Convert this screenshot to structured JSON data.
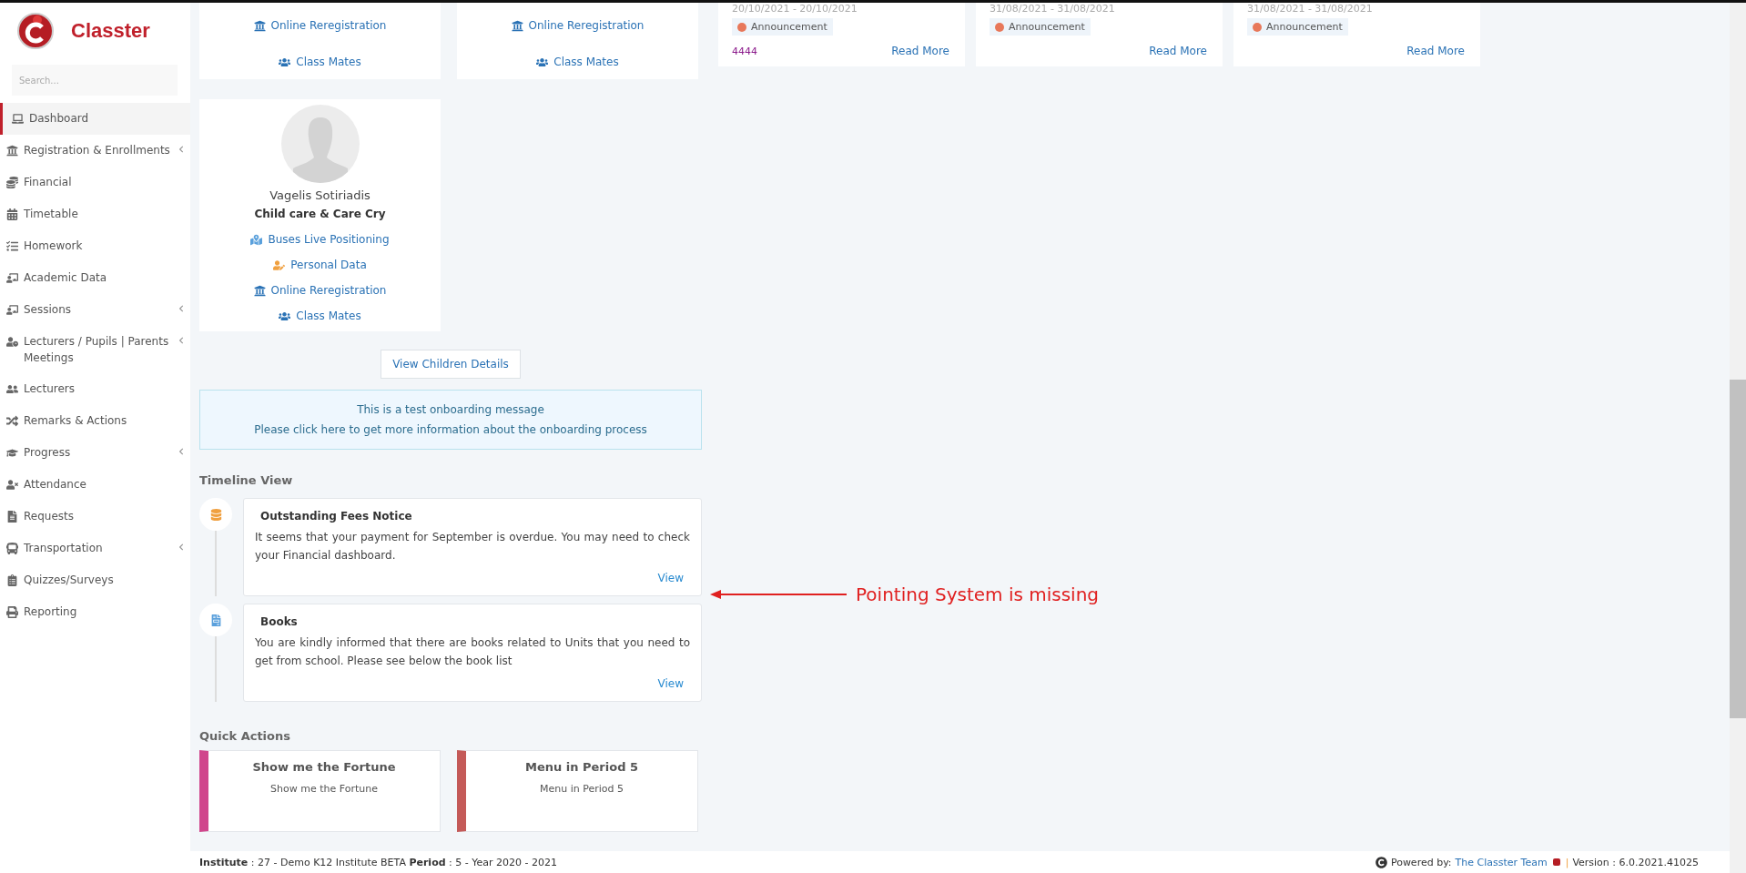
{
  "brand": {
    "name": "Classter"
  },
  "search": {
    "placeholder": "Search..."
  },
  "sidebar": {
    "items": [
      {
        "label": "Dashboard",
        "selected": true,
        "expandable": false
      },
      {
        "label": "Registration & Enrollments",
        "selected": false,
        "expandable": true
      },
      {
        "label": "Financial",
        "selected": false,
        "expandable": false
      },
      {
        "label": "Timetable",
        "selected": false,
        "expandable": false
      },
      {
        "label": "Homework",
        "selected": false,
        "expandable": false
      },
      {
        "label": "Academic Data",
        "selected": false,
        "expandable": false
      },
      {
        "label": "Sessions",
        "selected": false,
        "expandable": true
      },
      {
        "label": "Lecturers / Pupils | Parents Meetings",
        "selected": false,
        "expandable": true
      },
      {
        "label": "Lecturers",
        "selected": false,
        "expandable": false
      },
      {
        "label": "Remarks & Actions",
        "selected": false,
        "expandable": false
      },
      {
        "label": "Progress",
        "selected": false,
        "expandable": true
      },
      {
        "label": "Attendance",
        "selected": false,
        "expandable": false
      },
      {
        "label": "Requests",
        "selected": false,
        "expandable": false
      },
      {
        "label": "Transportation",
        "selected": false,
        "expandable": true
      },
      {
        "label": "Quizzes/Surveys",
        "selected": false,
        "expandable": false
      },
      {
        "label": "Reporting",
        "selected": false,
        "expandable": false
      }
    ]
  },
  "children_cards": [
    {
      "links": [
        {
          "kind": "registration",
          "label": "Online Reregistration"
        },
        {
          "kind": "classmates",
          "label": "Class Mates"
        }
      ]
    },
    {
      "links": [
        {
          "kind": "registration",
          "label": "Online Reregistration"
        },
        {
          "kind": "classmates",
          "label": "Class Mates"
        }
      ]
    },
    {
      "name": "Vagelis Sotiriadis",
      "school": "Child care & Care Cry",
      "links": [
        {
          "kind": "buses",
          "label": "Buses Live Positioning"
        },
        {
          "kind": "personal",
          "label": "Personal Data"
        },
        {
          "kind": "registration",
          "label": "Online Reregistration"
        },
        {
          "kind": "classmates",
          "label": "Class Mates"
        }
      ]
    }
  ],
  "view_children_button": "View Children Details",
  "onboarding": {
    "title": "This is a test onboarding message",
    "link": "Please click here to get more information about the onboarding process"
  },
  "events": [
    {
      "date": "20/10/2021 - 20/10/2021",
      "tag": "Announcement",
      "color": "#e8785a",
      "note": "4444",
      "link": "Read More"
    },
    {
      "date": "31/08/2021 - 31/08/2021",
      "tag": "Announcement",
      "color": "#e8785a",
      "link": "Read More"
    },
    {
      "date": "31/08/2021 - 31/08/2021",
      "tag": "Announcement",
      "color": "#e8785a",
      "link": "Read More"
    }
  ],
  "timeline": {
    "title": "Timeline View",
    "items": [
      {
        "kind": "fees",
        "title": "Outstanding Fees Notice",
        "text": "It seems that your payment for September is overdue. You may need to check your Financial dashboard.",
        "link": "View"
      },
      {
        "kind": "books",
        "title": "Books",
        "text": "You are kindly informed that there are books related to Units that you need to get from school. Please see below the book list",
        "link": "View"
      }
    ]
  },
  "quick_actions": {
    "title": "Quick Actions",
    "items": [
      {
        "title": "Show me the Fortune",
        "subtitle": "Show me the Fortune",
        "color": "#d0468c"
      },
      {
        "title": "Menu in Period 5",
        "subtitle": "Menu in Period 5",
        "color": "#c45a58"
      }
    ]
  },
  "annotation": {
    "text": "Pointing System is missing"
  },
  "footer": {
    "info": "**Institute** : 27 - Demo K12 Institute BETA **Period** : 5 - Year 2020 - 2021",
    "powered": "Powered by:",
    "team": "The Classter Team",
    "separator": "|",
    "version": "Version : 6.0.2021.41025"
  }
}
